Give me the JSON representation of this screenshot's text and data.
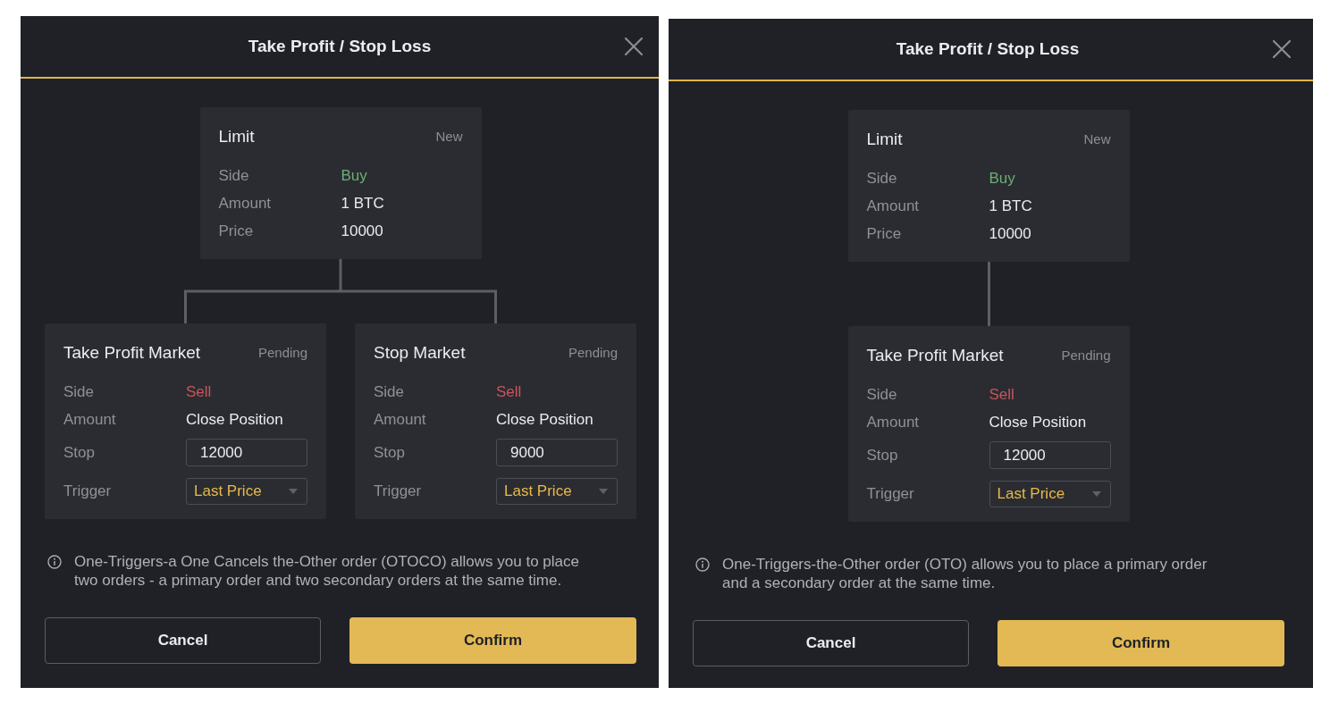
{
  "dialogs": [
    {
      "title": "Take Profit / Stop Loss",
      "primary_order": {
        "type": "Limit",
        "status": "New",
        "fields": [
          {
            "label": "Side",
            "value": "Buy",
            "kind": "buy"
          },
          {
            "label": "Amount",
            "value": "1 BTC",
            "kind": "text"
          },
          {
            "label": "Price",
            "value": "10000",
            "kind": "text"
          }
        ]
      },
      "secondary_orders": [
        {
          "type": "Take Profit Market",
          "status": "Pending",
          "fields": [
            {
              "label": "Side",
              "value": "Sell",
              "kind": "sell"
            },
            {
              "label": "Amount",
              "value": "Close Position",
              "kind": "text"
            },
            {
              "label": "Stop",
              "value": "12000",
              "kind": "input"
            },
            {
              "label": "Trigger",
              "value": "Last Price",
              "kind": "select"
            }
          ]
        },
        {
          "type": "Stop Market",
          "status": "Pending",
          "fields": [
            {
              "label": "Side",
              "value": "Sell",
              "kind": "sell"
            },
            {
              "label": "Amount",
              "value": "Close Position",
              "kind": "text"
            },
            {
              "label": "Stop",
              "value": "9000",
              "kind": "input"
            },
            {
              "label": "Trigger",
              "value": "Last Price",
              "kind": "select"
            }
          ]
        }
      ],
      "info": "One-Triggers-a One Cancels the-Other order (OTOCO) allows you to place two orders - a primary order and two secondary orders at the same time.",
      "buttons": [
        {
          "label": "Cancel",
          "kind": "cancel"
        },
        {
          "label": "Confirm",
          "kind": "confirm"
        }
      ]
    },
    {
      "title": "Take Profit / Stop Loss",
      "primary_order": {
        "type": "Limit",
        "status": "New",
        "fields": [
          {
            "label": "Side",
            "value": "Buy",
            "kind": "buy"
          },
          {
            "label": "Amount",
            "value": "1 BTC",
            "kind": "text"
          },
          {
            "label": "Price",
            "value": "10000",
            "kind": "text"
          }
        ]
      },
      "secondary_orders": [
        {
          "type": "Take Profit Market",
          "status": "Pending",
          "fields": [
            {
              "label": "Side",
              "value": "Sell",
              "kind": "sell"
            },
            {
              "label": "Amount",
              "value": "Close Position",
              "kind": "text"
            },
            {
              "label": "Stop",
              "value": "12000",
              "kind": "input"
            },
            {
              "label": "Trigger",
              "value": "Last Price",
              "kind": "select"
            }
          ]
        }
      ],
      "info": "One-Triggers-the-Other order (OTO) allows you to place a primary order and a secondary order at the same time.",
      "buttons": [
        {
          "label": "Cancel",
          "kind": "cancel"
        },
        {
          "label": "Confirm",
          "kind": "confirm"
        }
      ]
    }
  ]
}
